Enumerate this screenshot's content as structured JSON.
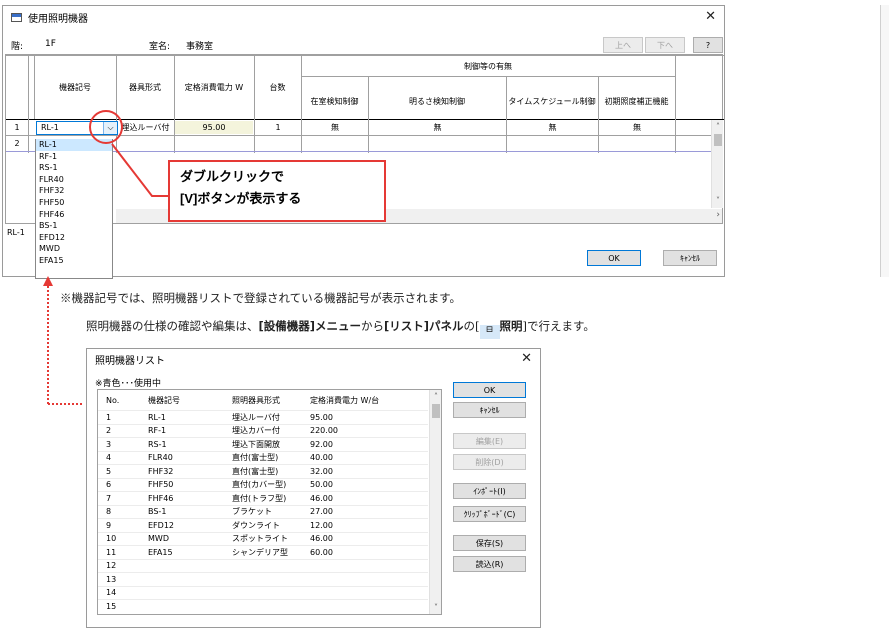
{
  "main_window": {
    "title": "使用照明機器",
    "floor_label": "階:",
    "floor_value": "1F",
    "room_label": "室名:",
    "room_value": "事務室",
    "up_label": "上へ",
    "down_label": "下へ",
    "help_label": "?",
    "headers": {
      "symbol": "機器記号",
      "form": "器具形式",
      "power": "定格消費電力 W",
      "count": "台数",
      "control_group": "制御等の有無",
      "presence": "在室検知制御",
      "brightness": "明るさ検知制御",
      "schedule": "タイムスケジュール制御",
      "initial": "初期照度補正機能"
    },
    "rows": [
      {
        "no": "1",
        "symbol": "RL-1",
        "form": "埋込ルーバ付",
        "power": "95.00",
        "count": "1",
        "presence": "無",
        "brightness": "無",
        "schedule": "無",
        "initial": "無"
      },
      {
        "no": "2"
      }
    ],
    "dropdown_items": [
      "RL-1",
      "RF-1",
      "RS-1",
      "FLR40",
      "FHF32",
      "FHF50",
      "FHF46",
      "BS-1",
      "EFD12",
      "MWD",
      "EFA15"
    ],
    "status_value": "RL-1",
    "ok_label": "OK",
    "cancel_label": "ｷｬﾝｾﾙ"
  },
  "callout": {
    "line1": "ダブルクリックで",
    "line2": "[V]ボタンが表示する"
  },
  "note": {
    "line1": "※機器記号では、照明機器リストで登録されている機器記号が表示されます。",
    "line2_a": "照明機器の仕様の確認や編集は、",
    "line2_b": "[設備機器]メニュー",
    "line2_c": "から",
    "line2_d": "[リスト]パネル",
    "line2_e": "の[",
    "line2_f": "照明",
    "line2_g": "]で行えます。"
  },
  "list_dialog": {
    "title": "照明機器リスト",
    "legend": "※青色･･･使用中",
    "columns": [
      "No.",
      "機器記号",
      "照明器具形式",
      "定格消費電力 W/台"
    ],
    "rows": [
      [
        "1",
        "RL-1",
        "埋込ルーバ付",
        "95.00"
      ],
      [
        "2",
        "RF-1",
        "埋込カバー付",
        "220.00"
      ],
      [
        "3",
        "RS-1",
        "埋込下面開放",
        "92.00"
      ],
      [
        "4",
        "FLR40",
        "直付(富士型)",
        "40.00"
      ],
      [
        "5",
        "FHF32",
        "直付(富士型)",
        "32.00"
      ],
      [
        "6",
        "FHF50",
        "直付(カバー型)",
        "50.00"
      ],
      [
        "7",
        "FHF46",
        "直付(トラフ型)",
        "46.00"
      ],
      [
        "8",
        "BS-1",
        "ブラケット",
        "27.00"
      ],
      [
        "9",
        "EFD12",
        "ダウンライト",
        "12.00"
      ],
      [
        "10",
        "MWD",
        "スポットライト",
        "46.00"
      ],
      [
        "11",
        "EFA15",
        "シャンデリア型",
        "60.00"
      ],
      [
        "12",
        "",
        "",
        ""
      ],
      [
        "13",
        "",
        "",
        ""
      ],
      [
        "14",
        "",
        "",
        ""
      ],
      [
        "15",
        "",
        "",
        ""
      ]
    ],
    "buttons": {
      "ok": "OK",
      "cancel": "ｷｬﾝｾﾙ",
      "edit": "編集(E)",
      "delete": "削除(D)",
      "import": "ｲﾝﾎﾟｰﾄ(I)",
      "clipboard": "ｸﾘｯﾌﾟﾎﾞｰﾄﾞ(C)",
      "save": "保存(S)",
      "load": "読込(R)"
    }
  },
  "colors": {
    "accent_red": "#e53935",
    "selection_blue": "#cce8ff",
    "grid_blue": "#0000c8"
  }
}
